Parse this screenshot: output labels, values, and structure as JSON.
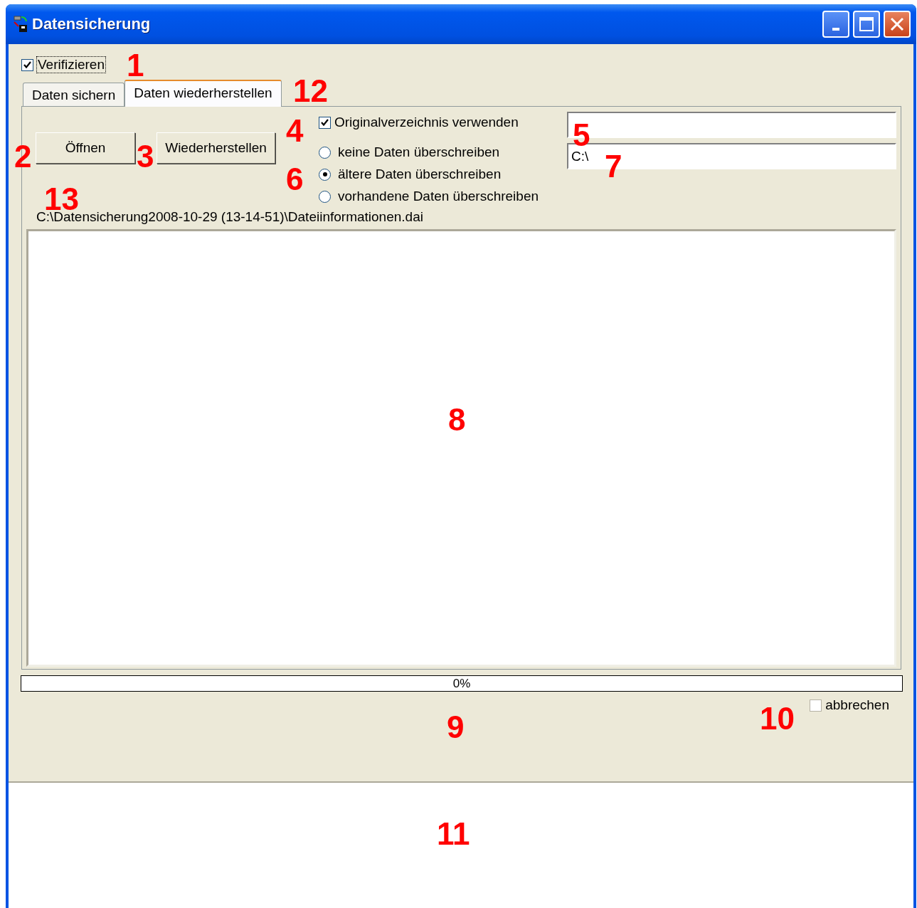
{
  "window": {
    "title": "Datensicherung"
  },
  "verify": {
    "label": "Verifizieren",
    "checked": true,
    "callout": "1"
  },
  "tabs": [
    {
      "label": "Daten sichern",
      "selected": false
    },
    {
      "label": "Daten wiederherstellen",
      "selected": true,
      "callout": "12"
    }
  ],
  "buttons": [
    {
      "label": "Öffnen",
      "callout": "2"
    },
    {
      "label": "Wiederherstellen",
      "callout": "3"
    }
  ],
  "use_original": {
    "label": "Originalverzeichnis verwenden",
    "checked": true,
    "callout": "4"
  },
  "overwrite_options": {
    "callout": "6",
    "options": [
      {
        "label": "keine Daten überschreiben",
        "selected": false
      },
      {
        "label": "ältere Daten überschreiben",
        "selected": true
      },
      {
        "label": "vorhandene Daten überschreiben",
        "selected": false
      }
    ]
  },
  "fields": [
    {
      "callout": "5"
    },
    {
      "value": "C:\\",
      "callout": "7"
    }
  ],
  "path": {
    "text": "C:\\Datensicherung2008-10-29 (13-14-51)\\Dateiinformationen.dai",
    "callout": "13"
  },
  "file_list": {
    "callout": "8"
  },
  "progress": {
    "level": 0,
    "reading": "0%",
    "callout": "9"
  },
  "abort": {
    "label": "abbrechen",
    "checked": false,
    "disabled": true,
    "callout": "10"
  },
  "log": {
    "callout": "11"
  }
}
